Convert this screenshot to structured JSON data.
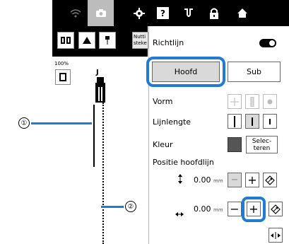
{
  "topbar": {
    "icons": [
      "wifi-icon",
      "camera-icon",
      "gear-icon",
      "help-icon",
      "needle-icon",
      "lock-icon",
      "home-icon"
    ],
    "help_label": "?"
  },
  "toolbar": {
    "text_button_label": "Nutti steke"
  },
  "left": {
    "zoom": "100%",
    "foot_label": "J"
  },
  "callouts": {
    "one": "①",
    "two": "②"
  },
  "panel": {
    "richtlijn_label": "Richtlijn",
    "richtlijn_on": true,
    "tab_hoofd": "Hoofd",
    "tab_sub": "Sub",
    "vorm_label": "Vorm",
    "lijnlengte_label": "Lijnlengte",
    "kleur_label": "Kleur",
    "select_label": "Selec-\nteren",
    "positie_label": "Positie hoofdlijn",
    "vert_value": "0.00",
    "horiz_value": "0.00",
    "unit": "mm",
    "minus": "−",
    "plus": "+"
  },
  "colors": {
    "highlight": "#1f7bd6",
    "bar": "#000000",
    "swatch": "#555555"
  }
}
